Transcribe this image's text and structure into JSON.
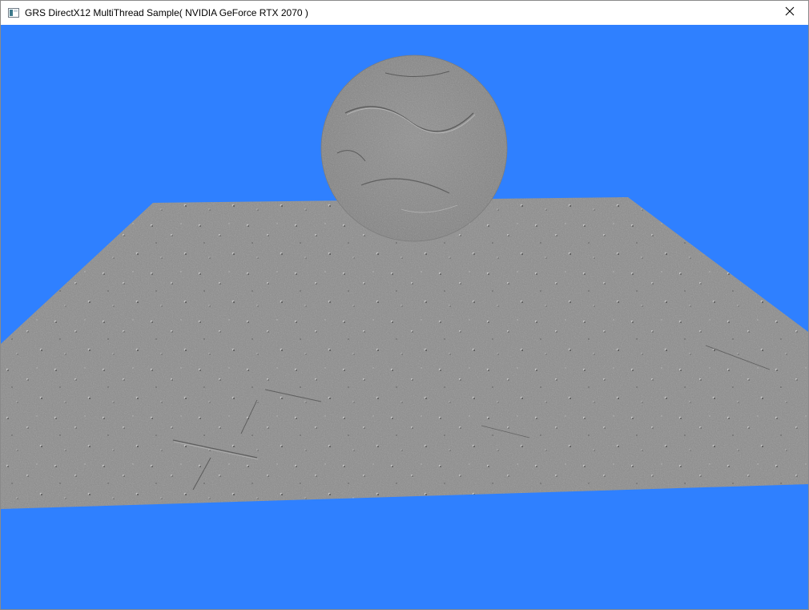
{
  "window": {
    "title": "GRS DirectX12 MultiThread Sample( NVIDIA GeForce RTX 2070 )",
    "icon": "app-window-icon",
    "close_icon": "close-icon"
  },
  "scene": {
    "clear_color": "#2f80ff",
    "surface_color": "#8a8a8a",
    "objects": [
      "textured-plane",
      "textured-sphere"
    ]
  }
}
